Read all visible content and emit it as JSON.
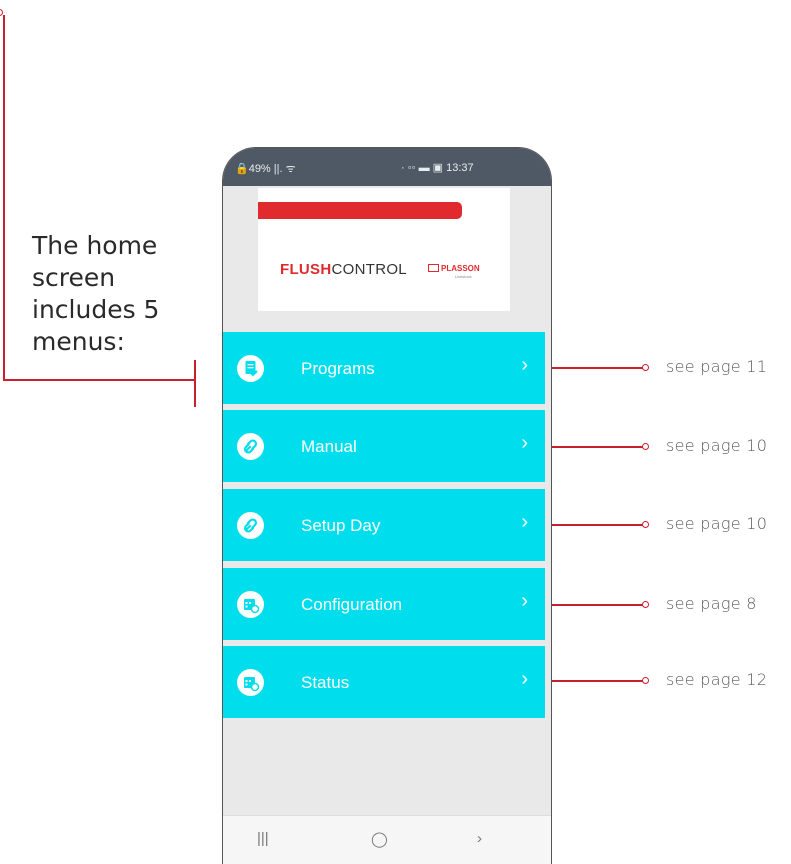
{
  "caption": {
    "line1": "The home",
    "line2": "screen",
    "line3": "includes 5",
    "line4": "menus:"
  },
  "phone": {
    "status_bar": {
      "left": "🔒49% ||. ᯤ",
      "right": "· ◦◦ ▬ ▣ 13:37"
    },
    "logo": {
      "brand_bold": "FLUSH",
      "brand_regular": "CONTROL",
      "partner": "PLASSON",
      "partner_sub": "Livestock"
    },
    "menu": [
      {
        "label": "Programs",
        "icon": "document-check-icon",
        "ref": "see page 11"
      },
      {
        "label": "Manual",
        "icon": "link-icon",
        "ref": "see page 10"
      },
      {
        "label": "Setup Day",
        "icon": "link-icon",
        "ref": "see page 10"
      },
      {
        "label": "Configuration",
        "icon": "calendar-clock-icon",
        "ref": "see page 8"
      },
      {
        "label": "Status",
        "icon": "calendar-clock-icon",
        "ref": "see page 12"
      }
    ],
    "chevron": "›",
    "nav": {
      "recents": "|||",
      "home": "◯",
      "back": "›"
    }
  },
  "colors": {
    "accent": "#00dded",
    "annotation": "#c8202c",
    "status_bar": "#4e5965",
    "brand_red": "#e02a2e"
  }
}
